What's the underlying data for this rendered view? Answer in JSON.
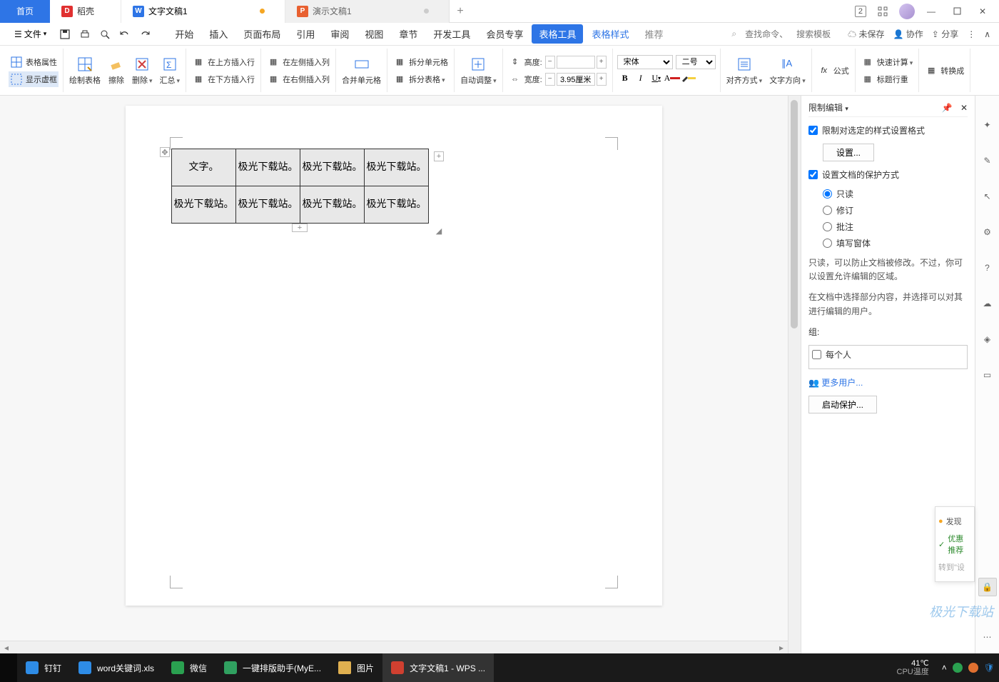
{
  "titlebar": {
    "home": "首页",
    "shell": "稻壳",
    "doc1": "文字文稿1",
    "doc2": "演示文稿1",
    "window_number": "2"
  },
  "menubar": {
    "file": "文件",
    "tabs": [
      "开始",
      "插入",
      "页面布局",
      "引用",
      "审阅",
      "视图",
      "章节",
      "开发工具",
      "会员专享"
    ],
    "table_tools": "表格工具",
    "table_style": "表格样式",
    "recommend": "推荐",
    "search_cmd_ph": "查找命令、",
    "search_tpl_ph": "搜索模板",
    "unsaved": "未保存",
    "collab": "协作",
    "share": "分享"
  },
  "ribbon": {
    "table_props": "表格属性",
    "show_frame": "显示虚框",
    "draw_table": "绘制表格",
    "eraser": "擦除",
    "delete": "删除",
    "summary": "汇总",
    "insert_above": "在上方插入行",
    "insert_below": "在下方插入行",
    "insert_left": "在左侧插入列",
    "insert_right": "在右侧插入列",
    "merge_cells": "合并单元格",
    "split_cells": "拆分单元格",
    "split_table": "拆分表格",
    "autofit": "自动调整",
    "height_lbl": "高度:",
    "width_lbl": "宽度:",
    "height_val": "",
    "width_val": "3.95厘米",
    "font_name": "宋体",
    "font_size": "二号",
    "align": "对齐方式",
    "text_dir": "文字方向",
    "formula": "公式",
    "quick_calc": "快速计算",
    "title_row": "标题行重",
    "convert": "转换成"
  },
  "table": {
    "rows": [
      [
        "文字。",
        "极光下载站。",
        "极光下载站。",
        "极光下载站。"
      ],
      [
        "极光下载站。",
        "极光下载站。",
        "极光下载站。",
        "极光下载站。"
      ]
    ]
  },
  "sidepanel": {
    "title": "限制编辑",
    "opt_style": "限制对选定的样式设置格式",
    "settings_btn": "设置...",
    "opt_protect": "设置文档的保护方式",
    "radio_readonly": "只读",
    "radio_track": "修订",
    "radio_comment": "批注",
    "radio_form": "填写窗体",
    "desc1": "只读，可以防止文档被修改。不过，你可以设置允许编辑的区域。",
    "desc2": "在文档中选择部分内容，并选择可以对其进行编辑的用户。",
    "group_lbl": "组:",
    "everyone": "每个人",
    "more_users": "更多用户...",
    "start_protect": "启动保护..."
  },
  "floatbox": {
    "discover": "发现",
    "rec": "优惠推荐",
    "goto": "转到\"设"
  },
  "taskbar": {
    "items": [
      "钉钉",
      "word关键词.xls",
      "微信",
      "一键排版助手(MyE...",
      "图片",
      "文字文稿1 - WPS ..."
    ],
    "temp": "41℃",
    "temp_lbl": "CPU温度"
  },
  "watermark": "极光下载站"
}
